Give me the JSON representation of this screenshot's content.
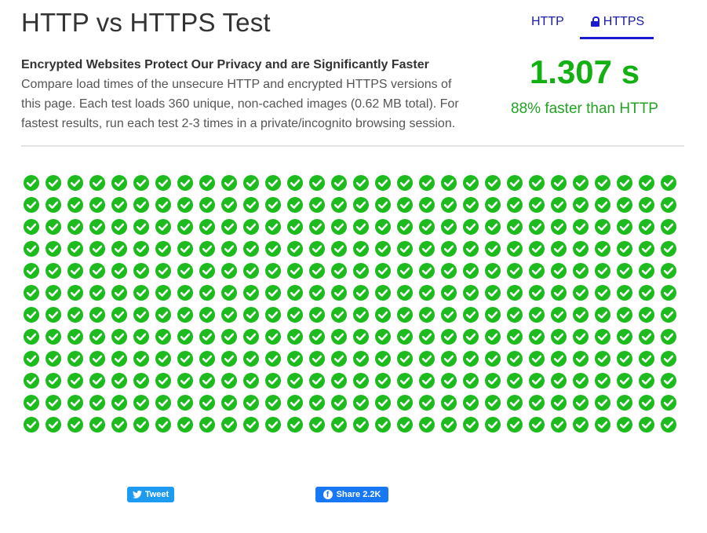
{
  "page": {
    "title": "HTTP vs HTTPS Test"
  },
  "intro": {
    "heading": "Encrypted Websites Protect Our Privacy and are Significantly Faster",
    "body": "Compare load times of the unsecure HTTP and encrypted HTTPS versions of this page. Each test loads 360 unique, non-cached images (0.62 MB total). For fastest results, run each test 2-3 times in a private/incognito browsing session."
  },
  "tabs": [
    {
      "label": "HTTP",
      "active": false
    },
    {
      "label": "HTTPS",
      "active": true,
      "icon": "lock-icon"
    }
  ],
  "result": {
    "time": "1.307 s",
    "faster_text": "88% faster than HTTP",
    "color": "#13b013"
  },
  "images_grid": {
    "status_icon": "check-circle-icon",
    "rows": 12,
    "columns": 30,
    "loaded": 360,
    "color": "#1dbb1d"
  },
  "share": {
    "tweet_label": "Tweet",
    "tweet_icon": "twitter-bird-icon",
    "tweet_color": "#1d9bf0",
    "fb_label": "Share 2.2K",
    "fb_icon": "facebook-icon",
    "fb_color": "#1877f2"
  }
}
